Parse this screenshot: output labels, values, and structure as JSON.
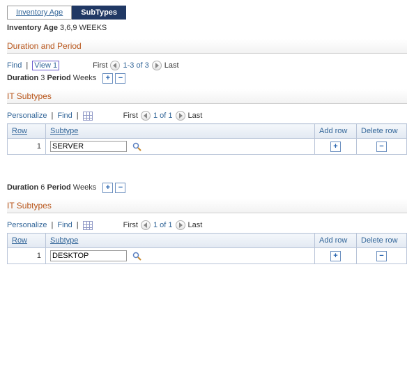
{
  "tabs": {
    "inventory_age": "Inventory Age",
    "subtypes": "SubTypes"
  },
  "header": {
    "label": "Inventory Age",
    "value": "3,6,9 WEEKS"
  },
  "section_duration": "Duration and Period",
  "nav1": {
    "find": "Find",
    "view1": "View 1",
    "first": "First",
    "range": "1-3 of 3",
    "last": "Last"
  },
  "dur": {
    "duration_label": "Duration",
    "period_label": "Period"
  },
  "section_subtypes": "IT Subtypes",
  "grid_nav": {
    "personalize": "Personalize",
    "find": "Find",
    "first": "First",
    "last": "Last"
  },
  "grid_headers": {
    "row": "Row",
    "subtype": "Subtype",
    "add": "Add row",
    "del": "Delete row"
  },
  "block_a": {
    "duration": "3",
    "period": "Weeks",
    "grid_range": "1 of 1",
    "rows": [
      {
        "row": "1",
        "subtype": "SERVER"
      }
    ]
  },
  "block_b": {
    "duration": "6",
    "period": "Weeks",
    "grid_range": "1 of 1",
    "rows": [
      {
        "row": "1",
        "subtype": "DESKTOP"
      }
    ]
  }
}
